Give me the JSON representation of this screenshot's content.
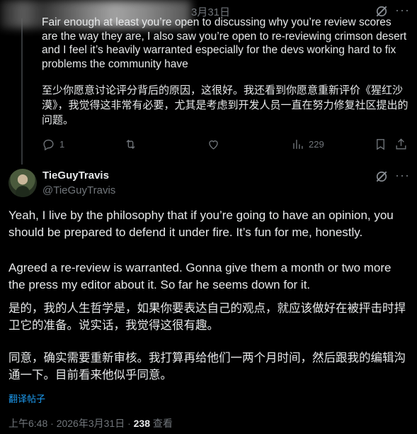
{
  "parent": {
    "date": "3月31日",
    "text": "Fair enough at least you’re open to discussing why you’re review scores are the way they are, I also saw you’re open to re-reviewing crimson desert and I feel it’s heavily warranted especially for the devs working hard to fix problems the community have",
    "translation": "至少你愿意讨论评分背后的原因，这很好。我还看到你愿意重新评价《猩红沙漠》，我觉得这非常有必要，尤其是考虑到开发人员一直在努力修复社区提出的问题。",
    "replies": "1",
    "views": "229"
  },
  "tweet": {
    "name": "TieGuyTravis",
    "handle": "@TieGuyTravis",
    "p1": "Yeah, I live by the philosophy that if you’re going to have an opinion, you should be prepared to defend it under fire. It’s fun for me, honestly.",
    "p2": "Agreed a re-review is warranted. Gonna give them a month or two more the press my editor about it. So far he seems down for it.",
    "zh1": "是的，我的人生哲学是，如果你要表达自己的观点，就应该做好在被抨击时捍卫它的准备。说实话，我觉得这很有趣。",
    "zh2": "同意，确实需要重新审核。我打算再给他们一两个月时间，然后跟我的编辑沟通一下。目前看来他似乎同意。",
    "translate_label": "翻译帖子",
    "time": "上午6:48 · 2026年3月31日 · ",
    "views": "238",
    "views_label": " 查看"
  },
  "colors": {
    "accent": "#1d9bf0",
    "muted": "#71767b",
    "text": "#e7e9ea",
    "bg": "#000000"
  }
}
